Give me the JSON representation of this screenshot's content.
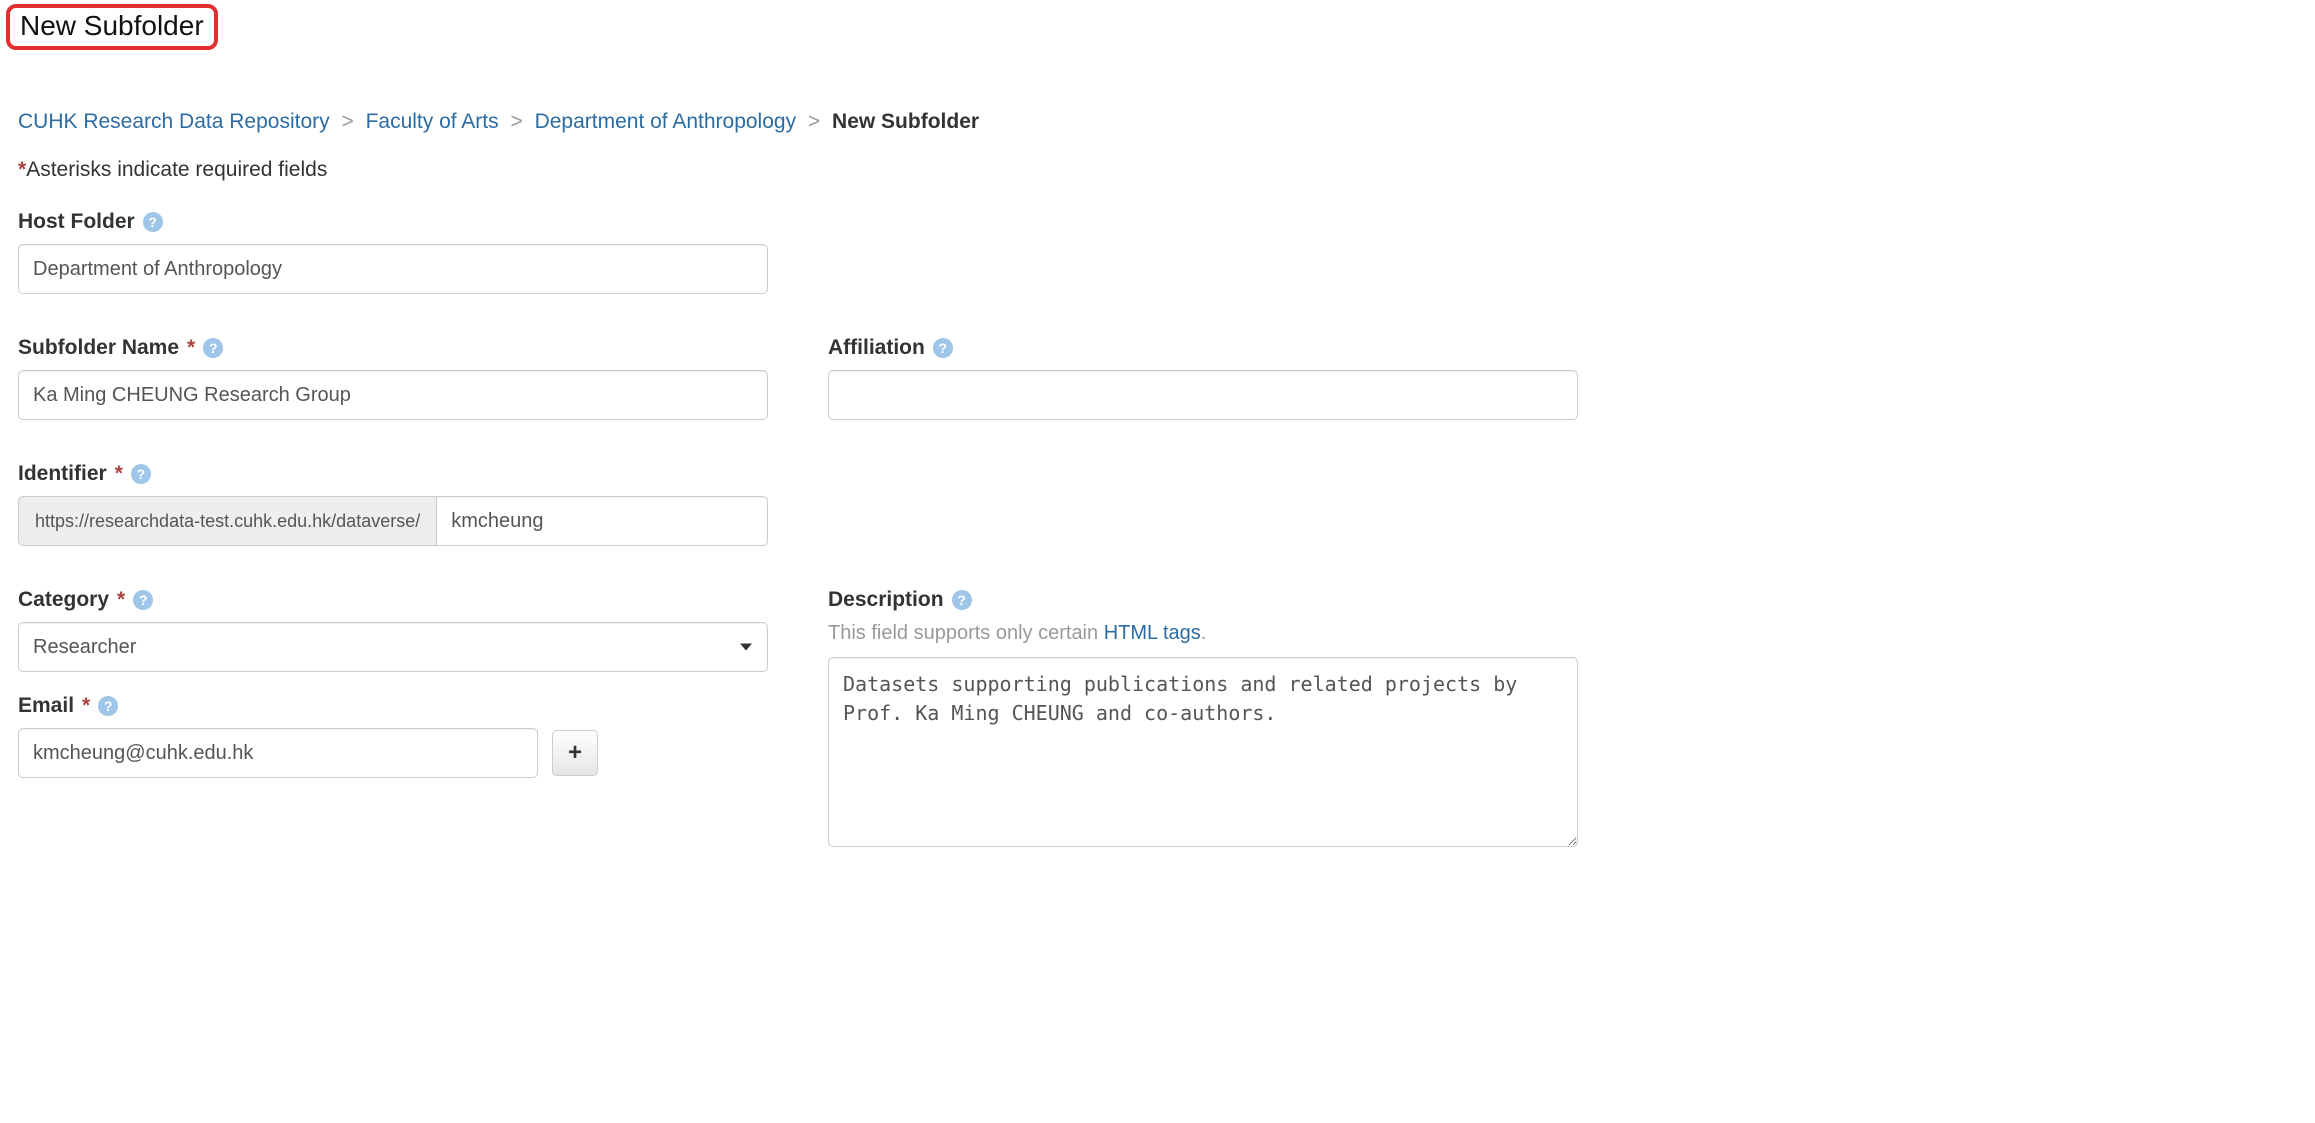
{
  "title": "New Subfolder",
  "breadcrumb": {
    "items": [
      {
        "label": "CUHK Research Data Repository"
      },
      {
        "label": "Faculty of Arts"
      },
      {
        "label": "Department of Anthropology"
      }
    ],
    "current": "New Subfolder",
    "sep": ">"
  },
  "required_note": "Asterisks indicate required fields",
  "labels": {
    "host_folder": "Host Folder",
    "subfolder_name": "Subfolder Name",
    "affiliation": "Affiliation",
    "identifier": "Identifier",
    "category": "Category",
    "description": "Description",
    "email": "Email"
  },
  "values": {
    "host_folder": "Department of Anthropology",
    "subfolder_name": "Ka Ming CHEUNG Research Group",
    "affiliation": "",
    "identifier_prefix": "https://researchdata-test.cuhk.edu.hk/dataverse/",
    "identifier": "kmcheung",
    "category": "Researcher",
    "email": "kmcheung@cuhk.edu.hk",
    "description": "Datasets supporting publications and related projects by Prof. Ka Ming CHEUNG and co-authors."
  },
  "description_hint": {
    "prefix": "This field supports only certain ",
    "link": "HTML tags",
    "suffix": "."
  },
  "icons": {
    "help": "?",
    "plus": "+"
  }
}
